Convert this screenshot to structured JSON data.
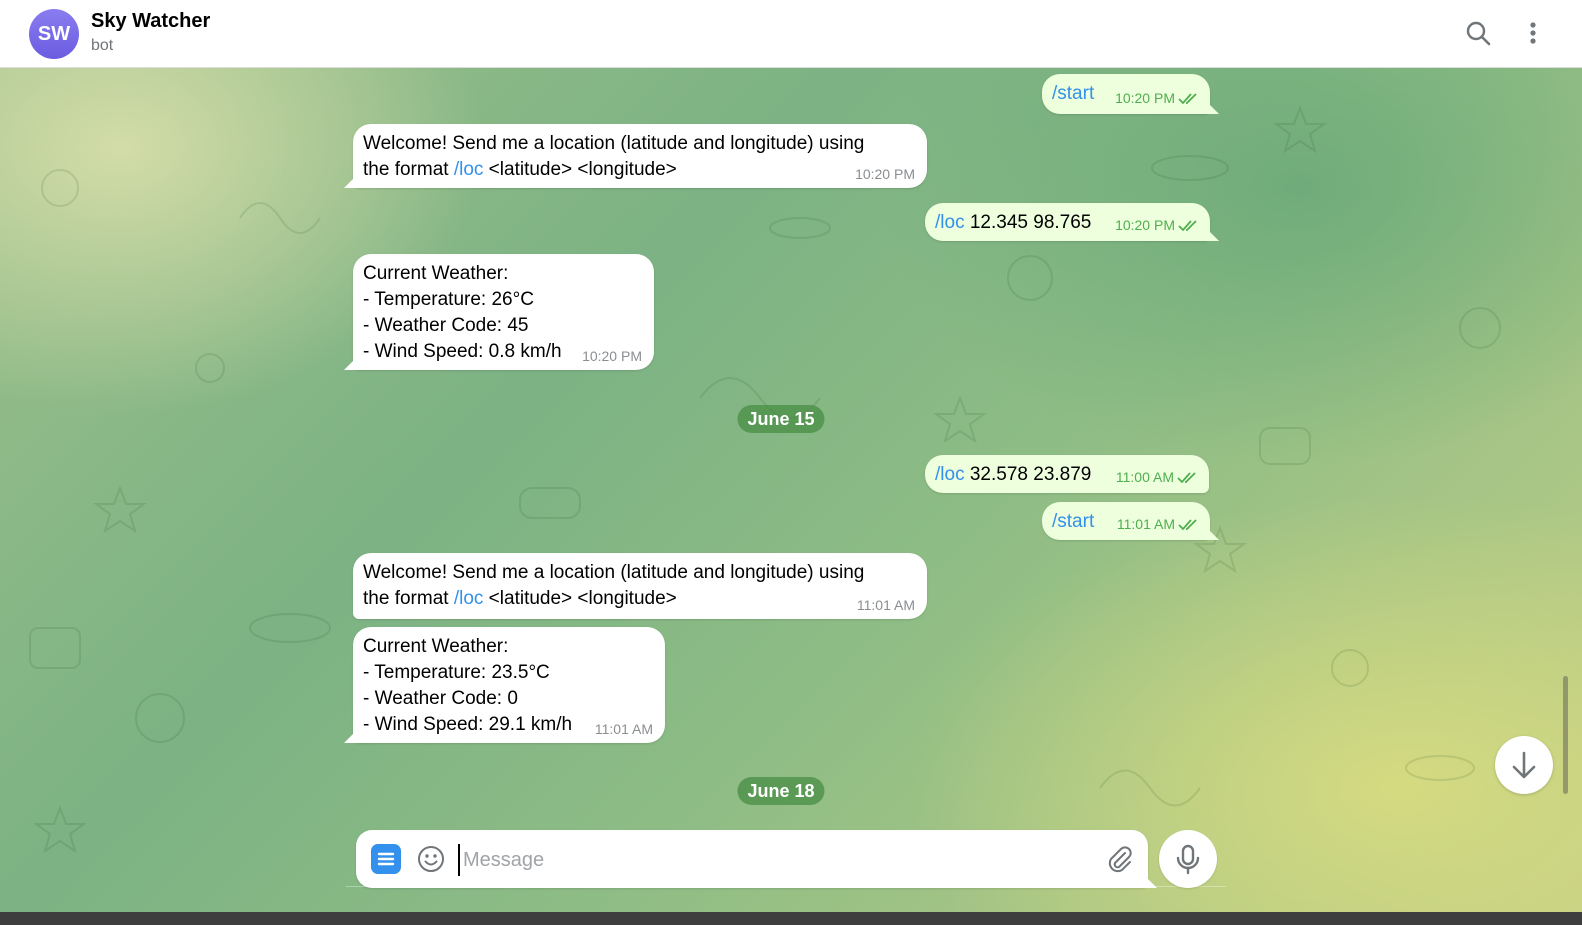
{
  "header": {
    "avatar_initials": "SW",
    "avatar_color": "#7b6ef0",
    "title": "Sky Watcher",
    "subtitle": "bot",
    "icons": [
      "search-icon",
      "more-vertical-icon"
    ]
  },
  "messages": [
    {
      "dir": "out",
      "cmd": "/start",
      "text": "",
      "time": "10:20 PM",
      "status": "read"
    },
    {
      "dir": "in",
      "line1": "Welcome! Send me a location (latitude and longitude) using",
      "line2_pre": "the format ",
      "line2_cmd": "/loc",
      "line2_post": " <latitude> <longitude>",
      "time": "10:20 PM"
    },
    {
      "dir": "out",
      "cmd": "/loc",
      "text": " 12.345 98.765",
      "time": "10:20 PM",
      "status": "read"
    },
    {
      "dir": "in",
      "lines": [
        "Current Weather:",
        "- Temperature: 26°C",
        "- Weather Code: 45",
        "- Wind Speed: 0.8 km/h"
      ],
      "time": "10:20 PM"
    },
    {
      "dir": "date",
      "label": "June 15"
    },
    {
      "dir": "out",
      "cmd": "/loc",
      "text": " 32.578 23.879",
      "time": "11:00 AM",
      "status": "read"
    },
    {
      "dir": "out",
      "cmd": "/start",
      "text": "",
      "time": "11:01 AM",
      "status": "read"
    },
    {
      "dir": "in",
      "line1": "Welcome! Send me a location (latitude and longitude) using",
      "line2_pre": "the format ",
      "line2_cmd": "/loc",
      "line2_post": " <latitude> <longitude>",
      "time": "11:01 AM"
    },
    {
      "dir": "in",
      "lines": [
        "Current Weather:",
        "- Temperature: 23.5°C",
        "- Weather Code: 0",
        "- Wind Speed: 29.1 km/h"
      ],
      "time": "11:01 AM"
    },
    {
      "dir": "date",
      "label": "June 18"
    }
  ],
  "composer": {
    "placeholder": "Message",
    "value": "",
    "icons": [
      "menu-icon",
      "emoji-icon",
      "attach-icon",
      "microphone-icon"
    ]
  },
  "colors": {
    "accent": "#3390ec",
    "outgoing_bubble": "#eeffde",
    "incoming_bubble": "#ffffff",
    "read_ticks": "#4fae4e",
    "date_pill": "#488e46"
  }
}
